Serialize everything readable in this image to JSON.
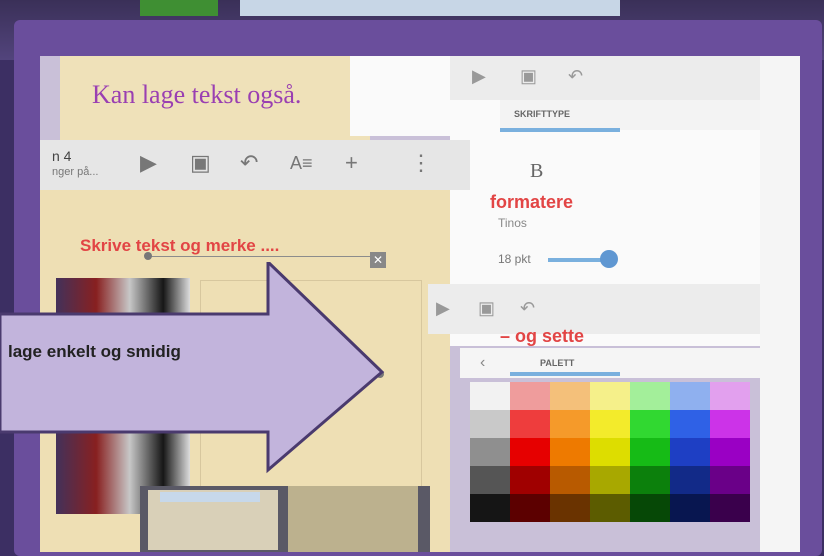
{
  "slide": {
    "sample_text": "Kan lage tekst også.",
    "toolbar_title": "n 4",
    "toolbar_subtitle": "nger på...",
    "tool_icons": [
      "play-icon",
      "save-icon",
      "undo-icon",
      "text-format-icon",
      "add-icon",
      "more-icon"
    ],
    "annotation_text": "Skrive tekst og merke ....",
    "close_symbol": "✕"
  },
  "format_panel": {
    "tabs": [
      "SKRIFTTYPE",
      "",
      ""
    ],
    "bold_label": "B",
    "annotation": "formatere",
    "font_name": "Tinos",
    "font_size": "18 pkt"
  },
  "palette_panel": {
    "annotation": "– og sette",
    "tab_label": "PALETT",
    "back_symbol": "‹",
    "colors": [
      "#f2f2f2",
      "#ef9c9c",
      "#f4c07a",
      "#f5f08a",
      "#a3ef9a",
      "#8fb0ef",
      "#e2a0ee",
      "#c9c9c9",
      "#ee3d3d",
      "#f59a2a",
      "#f3eb2b",
      "#31d831",
      "#2f61e6",
      "#cc33e8",
      "#8f8f8f",
      "#e60000",
      "#ee7a00",
      "#dddd00",
      "#16bb16",
      "#1e3fc4",
      "#9a00c4",
      "#555555",
      "#a00000",
      "#b85a00",
      "#a8a800",
      "#0c800c",
      "#122a88",
      "#6a0088",
      "#151515",
      "#5c0000",
      "#6a3300",
      "#5c5c00",
      "#064806",
      "#081650",
      "#3a004c"
    ]
  },
  "callout": {
    "text": "lage enkelt og smidig"
  },
  "colors": {
    "frame": "#6a4e9c",
    "callout_fill": "#c2b4dc",
    "annotation_red": "#e24545",
    "sample_purple": "#9a3fb2"
  }
}
